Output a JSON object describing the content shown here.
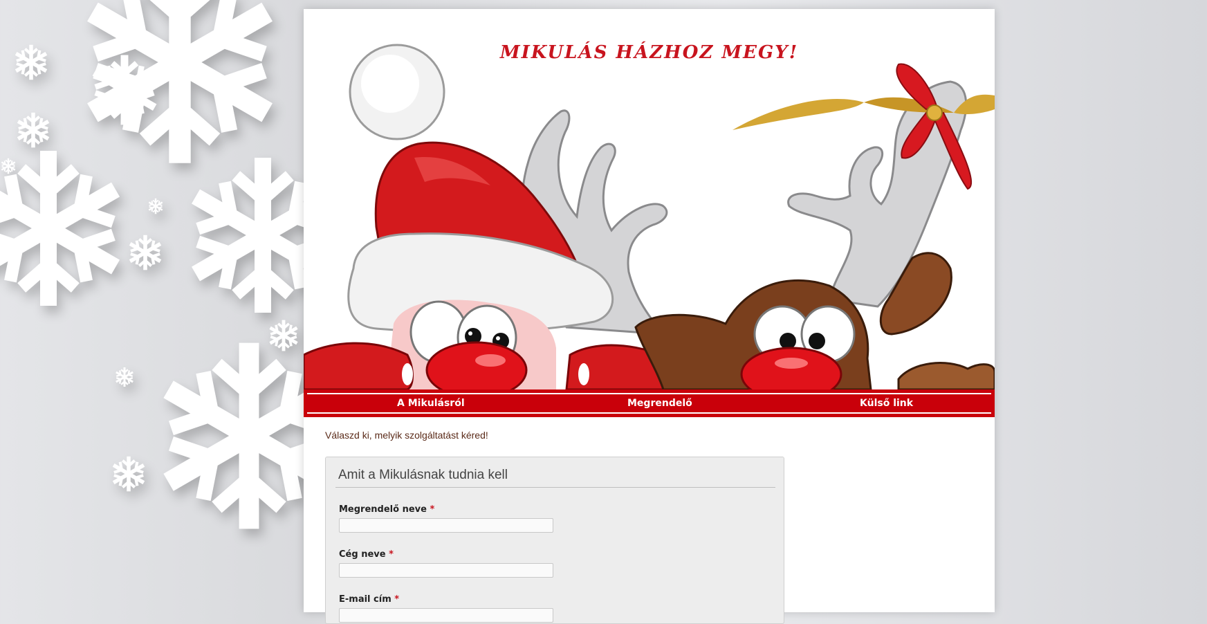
{
  "header": {
    "title": "MIKULÁS HÁZHOZ MEGY!"
  },
  "nav": {
    "items": [
      {
        "label": "A Mikulásról"
      },
      {
        "label": "Megrendelő"
      },
      {
        "label": "Külső link"
      }
    ]
  },
  "main": {
    "intro": "Válaszd ki, melyik szolgáltatást kéred!",
    "form": {
      "legend": "Amit a Mikulásnak tudnia kell",
      "required_mark": "*",
      "fields": [
        {
          "label": "Megrendelő neve",
          "value": ""
        },
        {
          "label": "Cég neve",
          "value": ""
        },
        {
          "label": "E-mail cím",
          "value": ""
        }
      ]
    }
  },
  "colors": {
    "accent": "#c9000a",
    "title": "#c8141e"
  }
}
